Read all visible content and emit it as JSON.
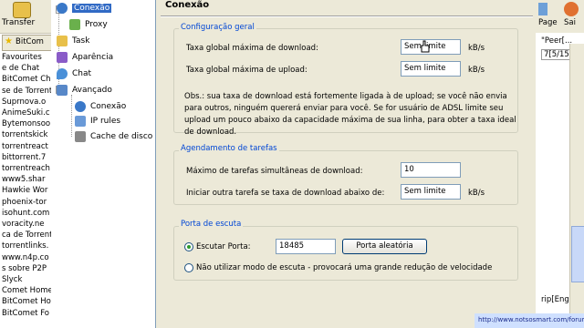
{
  "background": {
    "toolbar": {
      "transfer_label": "Transfer",
      "page_label": "Page",
      "right_label2": "Sai"
    },
    "tab_label": "BitCom",
    "list_items": [
      "Favourites",
      "e de Chat",
      "BitComet Ch",
      "se de Torrent",
      "Suprnova.o",
      "AnimeSuki.c",
      "Bytemonsoo",
      "torrentskick",
      "torrentreact",
      "bittorrent.7",
      "torrentreach",
      "www5.shar",
      "Hawkie Wor",
      "phoenix-tor",
      "isohunt.com",
      "voracity.ne",
      "ca de Torrent",
      "torrentlinks.",
      "www.n4p.co",
      "s sobre P2P",
      "Slyck",
      "Comet Homef",
      "BitComet Ho",
      "BitComet Fo"
    ],
    "right_col": {
      "line1": "\"Peer[...",
      "line2": "7[5/150]",
      "line3": "rip[Eng]-"
    },
    "url_strip": "http://www.notsosmart.com/forum/jigsaw?id=120000"
  },
  "tree": {
    "items": [
      {
        "label": "Conexão",
        "icon": "globe-icon",
        "selected": true
      },
      {
        "label": "Proxy",
        "icon": "proxy-icon"
      },
      {
        "label": "Task",
        "icon": "folder-icon"
      },
      {
        "label": "Aparência",
        "icon": "appearance-icon"
      },
      {
        "label": "Chat",
        "icon": "chat-icon"
      },
      {
        "label": "Avançado",
        "icon": "advanced-icon"
      },
      {
        "label": "Conexão",
        "icon": "network-icon"
      },
      {
        "label": "IP rules",
        "icon": "ip-rules-icon"
      },
      {
        "label": "Cache de disco",
        "icon": "disk-icon"
      }
    ]
  },
  "page_title": "Conexão",
  "general": {
    "title": "Configuração geral",
    "max_download_label": "Taxa global máxima de download:",
    "max_download_value": "Sem limite",
    "max_upload_label": "Taxa global máxima de upload:",
    "max_upload_value": "Sem limite",
    "unit": "kB/s",
    "obs": "Obs.: sua taxa de download está fortemente ligada à de upload; se você não envia para outros, ninguém quererá enviar para você. Se for usuário de ADSL limite seu upload um pouco abaixo da capacidade máxima de sua linha, para obter a taxa ideal de download."
  },
  "schedule": {
    "title": "Agendamento de tarefas",
    "max_tasks_label": "Máximo de tarefas simultâneas de download:",
    "max_tasks_value": "10",
    "start_task_label": "Iniciar outra tarefa se taxa de download abaixo de:",
    "start_task_value": "Sem limite",
    "unit": "kB/s"
  },
  "port": {
    "title": "Porta de escuta",
    "listen_label": "Escutar Porta:",
    "port_value": "18485",
    "random_button": "Porta aleatória",
    "no_listen_label": "Não utilizar modo de escuta - provocará uma grande redução de velocidade",
    "listen_selected": true
  }
}
